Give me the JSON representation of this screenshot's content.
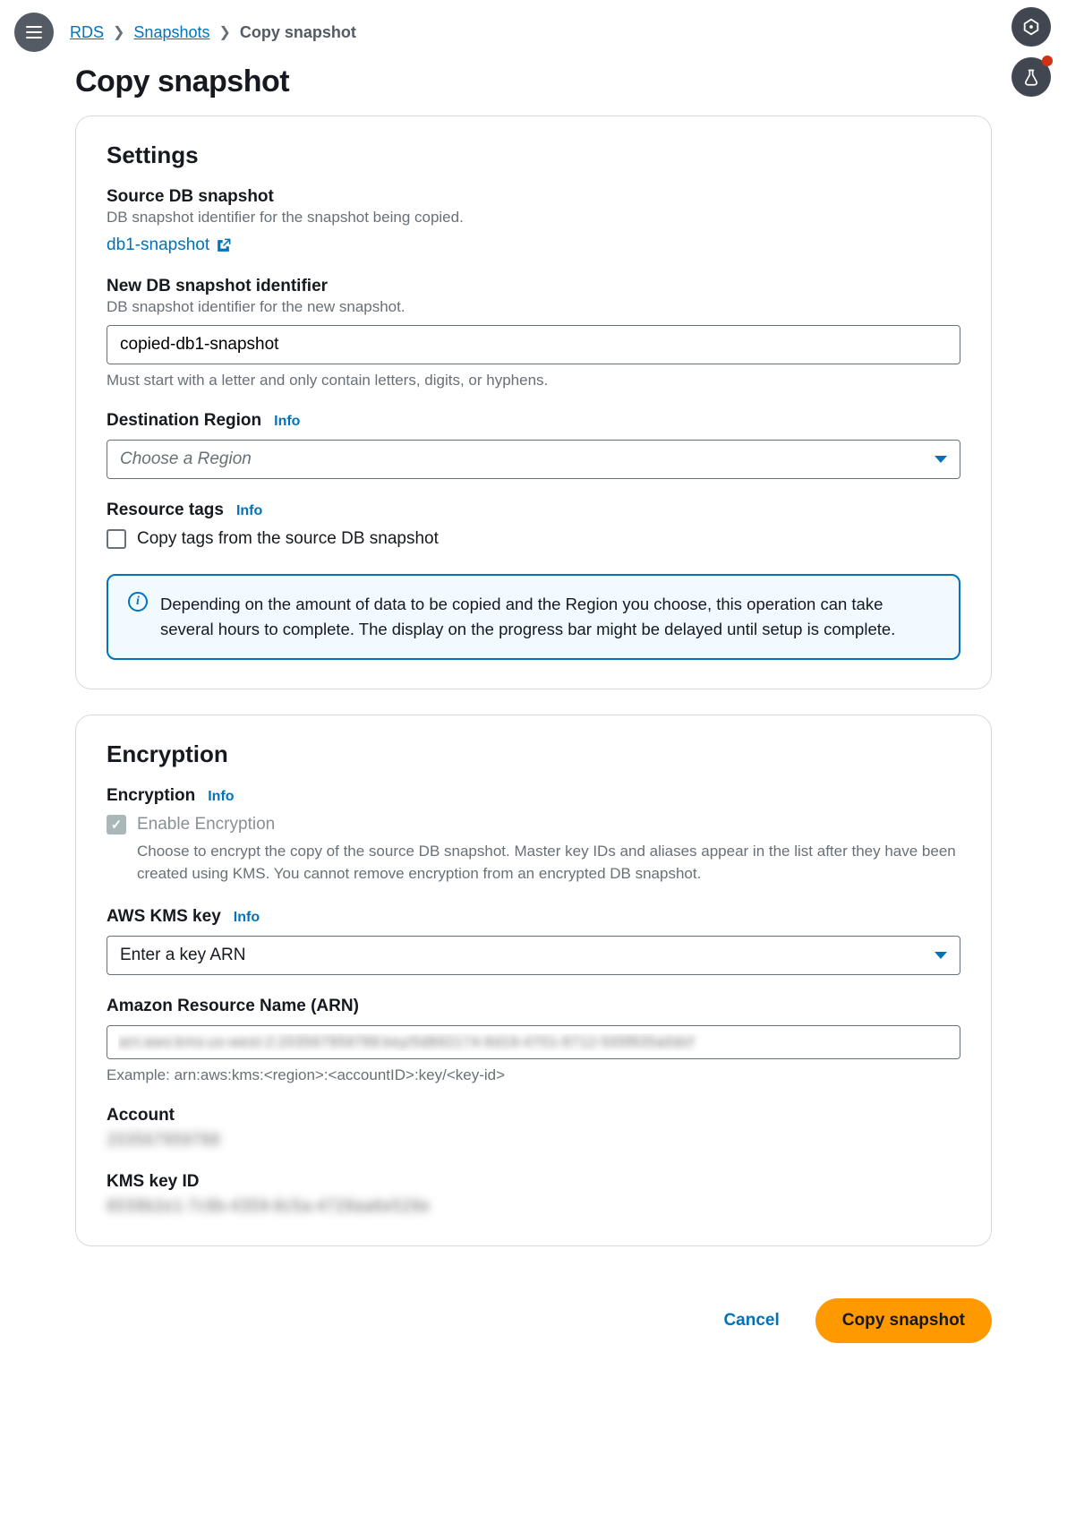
{
  "breadcrumb": {
    "rds": "RDS",
    "snapshots": "Snapshots",
    "current": "Copy snapshot"
  },
  "page_title": "Copy snapshot",
  "info_label": "Info",
  "settings": {
    "heading": "Settings",
    "source": {
      "label": "Source DB snapshot",
      "desc": "DB snapshot identifier for the snapshot being copied.",
      "link": "db1-snapshot"
    },
    "new_id": {
      "label": "New DB snapshot identifier",
      "desc": "DB snapshot identifier for the new snapshot.",
      "value": "copied-db1-snapshot",
      "helper": "Must start with a letter and only contain letters, digits, or hyphens."
    },
    "dest_region": {
      "label": "Destination Region",
      "placeholder": "Choose a Region"
    },
    "resource_tags": {
      "label": "Resource tags",
      "checkbox_label": "Copy tags from the source DB snapshot",
      "checked": false
    },
    "alert": "Depending on the amount of data to be copied and the Region you choose, this operation can take several hours to complete. The display on the progress bar might be delayed until setup is complete."
  },
  "encryption": {
    "heading": "Encryption",
    "label": "Encryption",
    "enable_label": "Enable Encryption",
    "enable_checked": true,
    "desc": "Choose to encrypt the copy of the source DB snapshot. Master key IDs and aliases appear in the list after they have been created using KMS. You cannot remove encryption from an encrypted DB snapshot.",
    "kms_key": {
      "label": "AWS KMS key",
      "value": "Enter a key ARN"
    },
    "arn": {
      "label": "Amazon Resource Name (ARN)",
      "value": "arn:aws:kms:us-west-2:203567959788:key/0d892174-8d19-4701-8712-500f835a0dcf",
      "example": "Example: arn:aws:kms:<region>:<accountID>:key/<key-id>"
    },
    "account": {
      "label": "Account",
      "value": "203567959788"
    },
    "kms_id": {
      "label": "KMS key ID",
      "value": "8039b2e1-7c9b-4359-8c5a-4728aa6e529e"
    }
  },
  "footer": {
    "cancel": "Cancel",
    "submit": "Copy snapshot"
  }
}
